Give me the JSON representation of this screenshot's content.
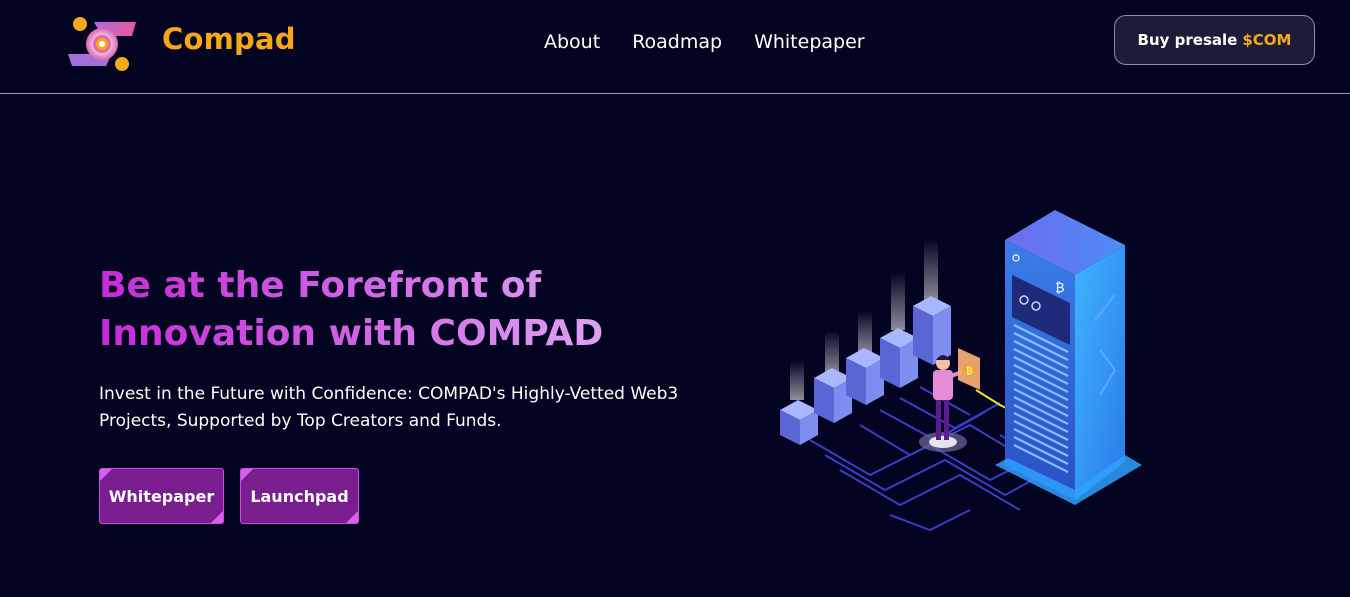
{
  "header": {
    "brand": "Compad",
    "nav": [
      {
        "label": "About"
      },
      {
        "label": "Roadmap"
      },
      {
        "label": "Whitepaper"
      }
    ],
    "buy_button": {
      "label": "Buy presale",
      "token": "$COM"
    }
  },
  "hero": {
    "title": "Be at the Forefront of Innovation with COMPAD",
    "subtitle": "Invest in the Future with Confidence: COMPAD's Highly-Vetted Web3 Projects, Supported by Top Creators and Funds.",
    "buttons": [
      {
        "label": "Whitepaper"
      },
      {
        "label": "Launchpad"
      }
    ]
  },
  "colors": {
    "background": "#030322",
    "brand_accent": "#f7a817",
    "heading_gradient_start": "#c72ad8",
    "heading_gradient_end": "#e2b0f4",
    "cta_fill": "#7a1d8f"
  },
  "icons": {
    "logo": "compad-logo-icon",
    "illustration": "crypto-server-illustration"
  }
}
